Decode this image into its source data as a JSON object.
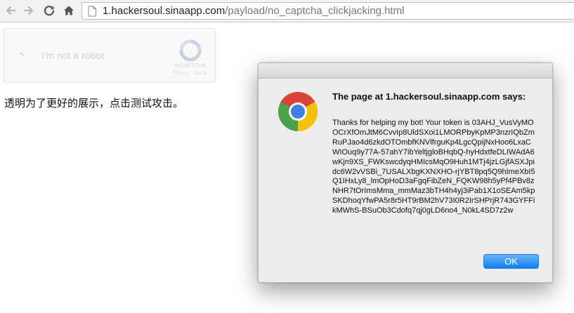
{
  "browser": {
    "icons": {
      "back": "back-arrow-icon",
      "forward": "forward-arrow-icon",
      "reload": "reload-icon",
      "home": "home-icon",
      "page": "page-icon"
    },
    "url_host": "1.hackersoul.sinaapp.com",
    "url_path": "/payload/no_captcha_clickjacking.html"
  },
  "page": {
    "recaptcha": {
      "label": "I'm not a robot",
      "brand": "reCAPTCHA",
      "privacy": "Privacy - Terms"
    },
    "description": "透明为了更好的展示，点击测试攻击。"
  },
  "dialog": {
    "icon": "chrome-logo-icon",
    "title": "The page at 1.hackersoul.sinaapp.com says:",
    "message": "Thanks for helping my bot! Your token is 03AHJ_VusVyMOOCrXfOmJtM6CvvIp8UldSXoi1LMORPbyKpMP3nzrIQbZmRuPJao4d6zkdOTOmbfKNVlfrguKp4LgcQpijNxHoo6LxaCWIOuq9y77A-57ahY7ibYeltjgloBHqbQ-hyHdxtfeDLIWAdA6wKjn9XS_FWKswcdyqHMIcsMqO9Huh1MTj4jzLGjfASXJpidc6W2vVSBi_7USALXbgKXNXHO-rjYBT8pq5Q9hImeXbI5Q1IHxLy8_lmOpHoD3aFgqFibZeN_FQKW98h5yPf4PBv8zNHR7tOrImsMma_mmMaz3bTH4h4yj3iPab1X1oSEAm5kpSKDhoqYfwPA5r8r5HT9rBM2hV73I0R2IrSHPrjR743GYFFikMWhS-BSuOb3Cdofq7qj0gLD6no4_N0kL4SD7z2w",
    "ok_label": "OK"
  },
  "colors": {
    "accent_button": "#1a86f2",
    "url_path": "#777777"
  }
}
